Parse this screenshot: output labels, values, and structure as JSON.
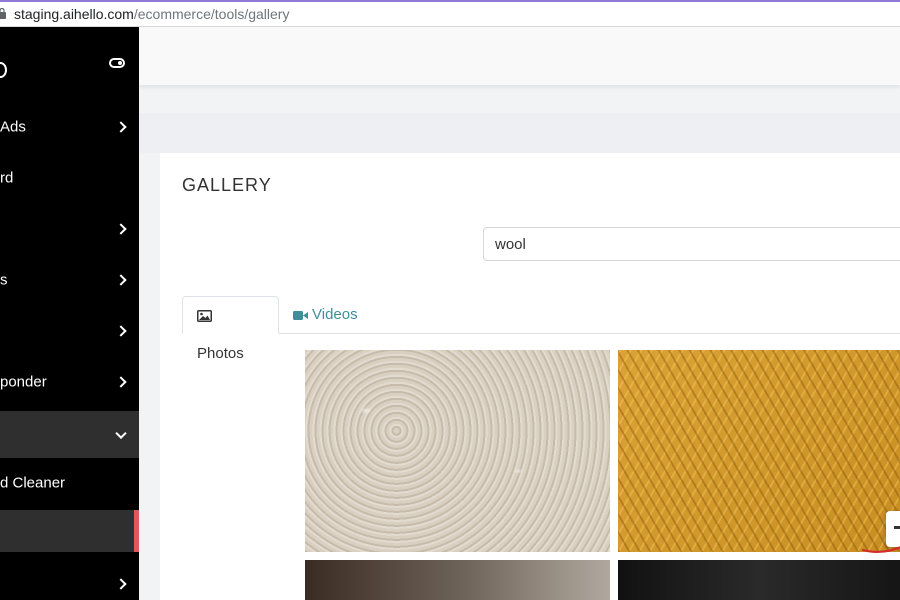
{
  "browser": {
    "url_host": "staging.aihello.com",
    "url_path": "/ecommerce/tools/gallery"
  },
  "sidebar": {
    "items": [
      {
        "label": "Ads",
        "chevron": true
      },
      {
        "label": "rd",
        "chevron": false
      },
      {
        "label": "",
        "chevron": true
      },
      {
        "label": "s",
        "chevron": true
      },
      {
        "label": "",
        "chevron": true
      },
      {
        "label": "ponder",
        "chevron": true
      },
      {
        "label": "",
        "chevron": true,
        "expanded": true
      },
      {
        "label": "d Cleaner",
        "chevron": false
      },
      {
        "label": "",
        "chevron": false,
        "active": true
      },
      {
        "label": "",
        "chevron": true
      }
    ]
  },
  "gallery": {
    "title": "GALLERY",
    "search_value": "wool",
    "tabs": [
      {
        "label": "Photos",
        "icon": "image-icon",
        "active": true
      },
      {
        "label": "Videos",
        "icon": "video-camera-icon",
        "active": false
      }
    ]
  },
  "colors": {
    "sidebar_bg": "#000000",
    "active_accent": "#e0575b",
    "tab_link": "#3e8f9a"
  }
}
